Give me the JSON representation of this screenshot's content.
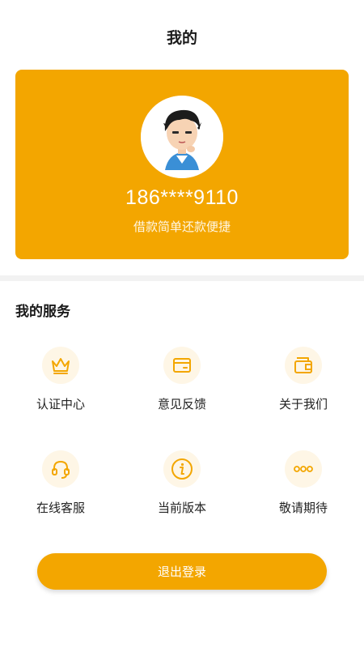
{
  "header": {
    "title": "我的"
  },
  "profile": {
    "phone": "186****9110",
    "slogan": "借款简单还款便捷"
  },
  "services": {
    "title": "我的服务",
    "items": [
      {
        "label": "认证中心",
        "icon": "crown-icon"
      },
      {
        "label": "意见反馈",
        "icon": "card-icon"
      },
      {
        "label": "关于我们",
        "icon": "wallet-icon"
      },
      {
        "label": "在线客服",
        "icon": "headset-icon"
      },
      {
        "label": "当前版本",
        "icon": "info-icon"
      },
      {
        "label": "敬请期待",
        "icon": "more-icon"
      }
    ]
  },
  "logout": {
    "label": "退出登录"
  },
  "colors": {
    "accent": "#F3A600",
    "icon_bg": "#FEF6E6"
  }
}
